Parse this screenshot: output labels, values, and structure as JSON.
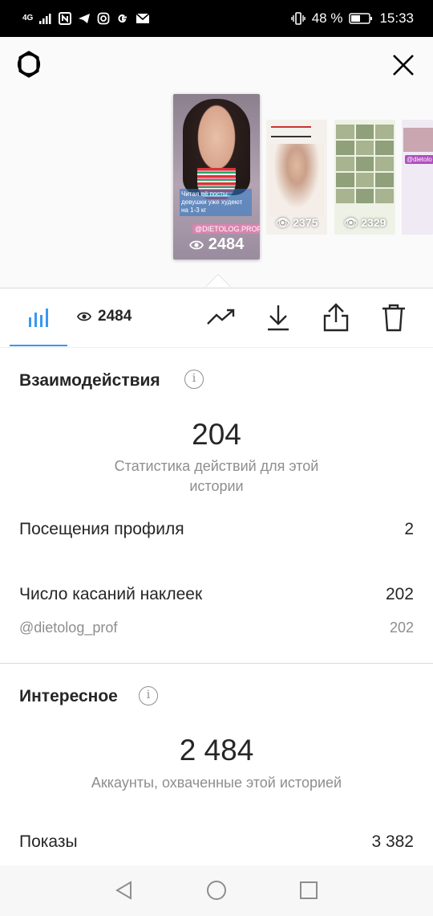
{
  "status_bar": {
    "network": "4G",
    "battery": "48 %",
    "time": "15:33"
  },
  "stories": {
    "main": {
      "caption": "Читая её посты девушки уже худеют на 1-3 кг",
      "tag": "@DIETOLOG.PROF",
      "views": "2484"
    },
    "thumbnails": [
      {
        "views": "2375"
      },
      {
        "views": "2329"
      },
      {
        "tag": "@dietolo"
      }
    ]
  },
  "tabs": {
    "views": "2484"
  },
  "interactions": {
    "title": "Взаимодействия",
    "total": "204",
    "caption": "Статистика действий для этой истории",
    "profile_visits_label": "Посещения профиля",
    "profile_visits_value": "2",
    "sticker_taps_label": "Число касаний наклеек",
    "sticker_taps_value": "202",
    "sticker_handle": "@dietolog_prof",
    "sticker_handle_value": "202"
  },
  "discovery": {
    "title": "Интересное",
    "reach": "2 484",
    "caption": "Аккаунты, охваченные этой историей",
    "impressions_label": "Показы",
    "impressions_value": "3 382"
  },
  "colors": {
    "accent": "#3897f0",
    "text": "#262626",
    "secondary": "#8e8e8e"
  },
  "icons": {
    "settings": "settings-gear-icon",
    "close": "close-icon",
    "stats": "bar-chart-icon",
    "eye": "eye-icon",
    "promote": "trend-up-icon",
    "download": "download-icon",
    "share": "share-icon",
    "delete": "trash-icon",
    "info": "info-icon"
  }
}
